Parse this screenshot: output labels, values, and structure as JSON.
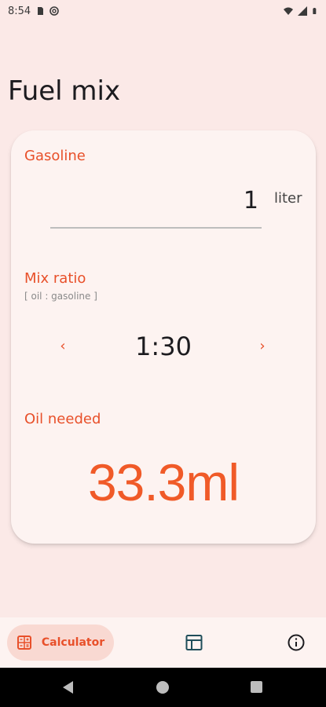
{
  "status_bar": {
    "time": "8:54",
    "icons": [
      "sd-card-icon",
      "at-sign-icon",
      "wifi-icon",
      "signal-icon",
      "battery-icon"
    ]
  },
  "app": {
    "title": "Fuel mix"
  },
  "card": {
    "gasoline": {
      "label": "Gasoline",
      "value": "1",
      "unit": "liter"
    },
    "mix_ratio": {
      "label": "Mix ratio",
      "hint": "[ oil : gasoline ]",
      "value": "1:30",
      "prev_symbol": "‹",
      "next_symbol": "›"
    },
    "oil_needed": {
      "label": "Oil needed",
      "value": "33.3ml"
    }
  },
  "bottom_nav": {
    "items": [
      {
        "label": "Calculator",
        "icon": "calculator-icon",
        "selected": true
      },
      {
        "label": "",
        "icon": "table-icon",
        "selected": false
      },
      {
        "label": "",
        "icon": "info-icon",
        "selected": false
      }
    ]
  },
  "colors": {
    "accent": "#e8502a",
    "background": "#fbe9e7",
    "card": "#fdf3f1",
    "nav_pill": "#f9d9d2"
  }
}
